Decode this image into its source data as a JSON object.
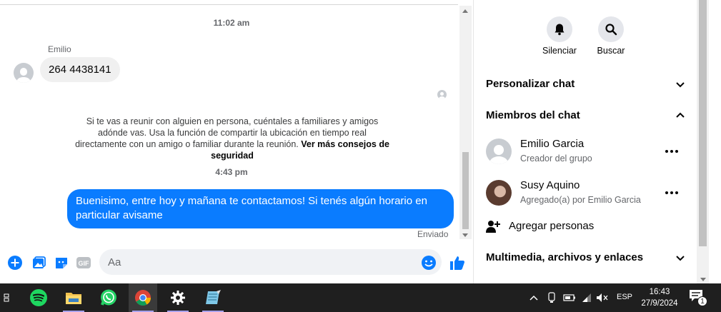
{
  "chat": {
    "timestamp_1": "11:02 am",
    "sender_name": "Emilio",
    "incoming_message": "264 4438141",
    "safety_notice": "Si te vas a reunir con alguien en persona, cuéntales a familiares y amigos adónde vas. Usa la función de compartir la ubicación en tiempo real directamente con un amigo o familiar durante la reunión.",
    "safety_link": "Ver más consejos de seguridad",
    "timestamp_2": "4:43 pm",
    "outgoing_message": "Buenisimo, entre hoy y mañana te contactamos! Si tenés algún horario en particular avisame",
    "sent_status": "Enviado"
  },
  "composer": {
    "placeholder": "Aa",
    "tools": [
      "add-icon",
      "image-icon",
      "sticker-icon",
      "gif-icon"
    ],
    "send_icon": "thumbs-up-icon",
    "emoji_icon": "emoji-icon"
  },
  "sidebar": {
    "actions": [
      {
        "label": "Silenciar",
        "icon": "bell-icon"
      },
      {
        "label": "Buscar",
        "icon": "search-icon"
      }
    ],
    "sections": {
      "customize": "Personalizar chat",
      "members": "Miembros del chat",
      "media": "Multimedia, archivos y enlaces"
    },
    "members": [
      {
        "name": "Emilio Garcia",
        "role": "Creador del grupo"
      },
      {
        "name": "Susy Aquino",
        "role": "Agregado(a) por Emilio Garcia"
      }
    ],
    "add_people": "Agregar personas"
  },
  "taskbar": {
    "apps": [
      "task-view-icon",
      "spotify-icon",
      "file-explorer-icon",
      "whatsapp-icon",
      "chrome-icon",
      "settings-icon",
      "notepad-icon"
    ],
    "language": "ESP",
    "time": "16:43",
    "date": "27/9/2024",
    "notification_count": "1"
  },
  "colors": {
    "accent": "#0a7cff",
    "bubble_in": "#f0f0f0",
    "taskbar": "#1f1f1f"
  }
}
